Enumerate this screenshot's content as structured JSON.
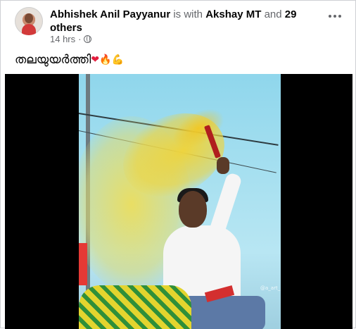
{
  "post": {
    "author": "Abhishek Anil Payyanur",
    "with_text": "is with",
    "tagged": "Akshay MT",
    "and_text": "and",
    "others": "29 others",
    "dot": ".",
    "time": "14 hrs",
    "dot_sep": "·",
    "caption": "തലയുയർത്തി",
    "caption_emojis": [
      "heart",
      "fire",
      "flexed-biceps"
    ],
    "privacy": "globe-icon"
  },
  "video": {
    "watermark": "@a_art_"
  },
  "colors": {
    "text": "#050505",
    "muted": "#65676b",
    "border": "#ced0d4"
  }
}
